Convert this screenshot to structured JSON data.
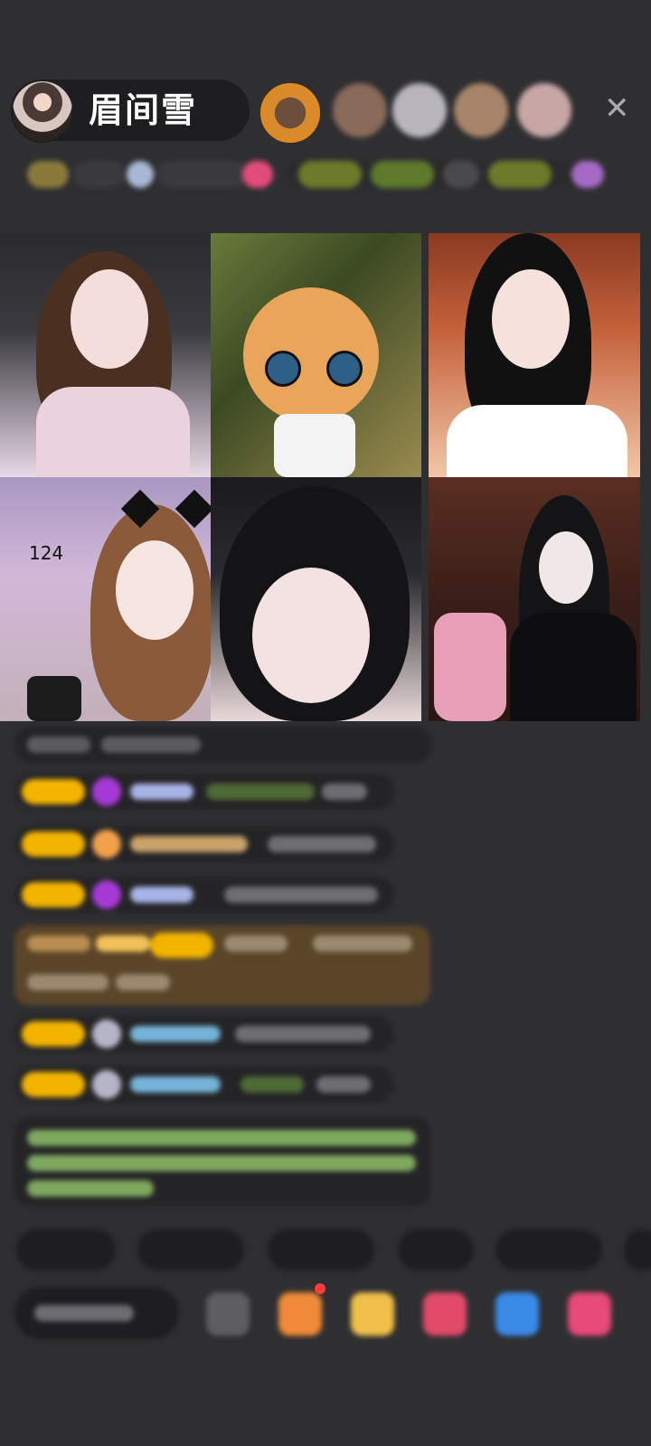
{
  "header": {
    "host_name": "眉间雪",
    "close_icon": "close-icon"
  },
  "grid": {
    "tile4_count": "124"
  },
  "colors": {
    "background": "#2f2f31",
    "badge": "#f3b400",
    "notice_text": "#a7e07a"
  }
}
